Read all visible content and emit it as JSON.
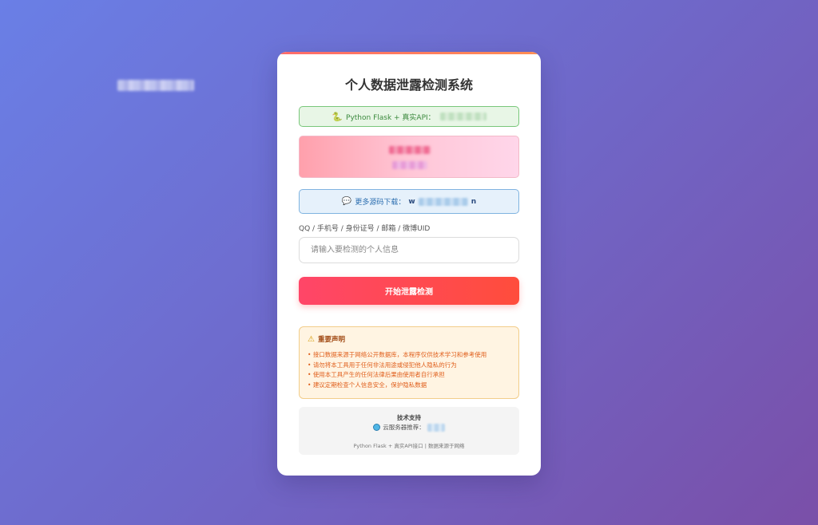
{
  "page": {
    "title": "个人数据泄露检测系统"
  },
  "tech_banner": {
    "icon": "snake-icon",
    "text": "Python Flask + 真实API："
  },
  "download_banner": {
    "icon": "chat-bubble-icon",
    "label": "更多源码下载：",
    "prefix": "w",
    "suffix": "n"
  },
  "form": {
    "label": "QQ / 手机号 / 身份证号 / 邮箱 / 微博UID",
    "placeholder": "请输入要检测的个人信息",
    "submit_label": "开始泄露检测"
  },
  "notice": {
    "icon": "warning-icon",
    "title": "重要声明",
    "items": [
      "接口数据来源于网络公开数据库，本程序仅供技术学习和参考使用",
      "请勿将本工具用于任何非法用途或侵犯他人隐私的行为",
      "使用本工具产生的任何法律后果由使用者自行承担",
      "建议定期检查个人信息安全，保护隐私数据"
    ]
  },
  "support": {
    "title": "技术支持",
    "server_icon": "globe-icon",
    "server_label": "云服务器推荐：",
    "footer": "Python Flask + 真实API接口 | 数据来源于网络"
  },
  "colors": {
    "background_start": "#6a7fe6",
    "background_end": "#7a4fa8",
    "button_start": "#ff4668",
    "button_end": "#ff4d3c",
    "tech_border": "#79c77a",
    "download_border": "#7fb3e0",
    "notice_border": "#f2cd8a"
  }
}
